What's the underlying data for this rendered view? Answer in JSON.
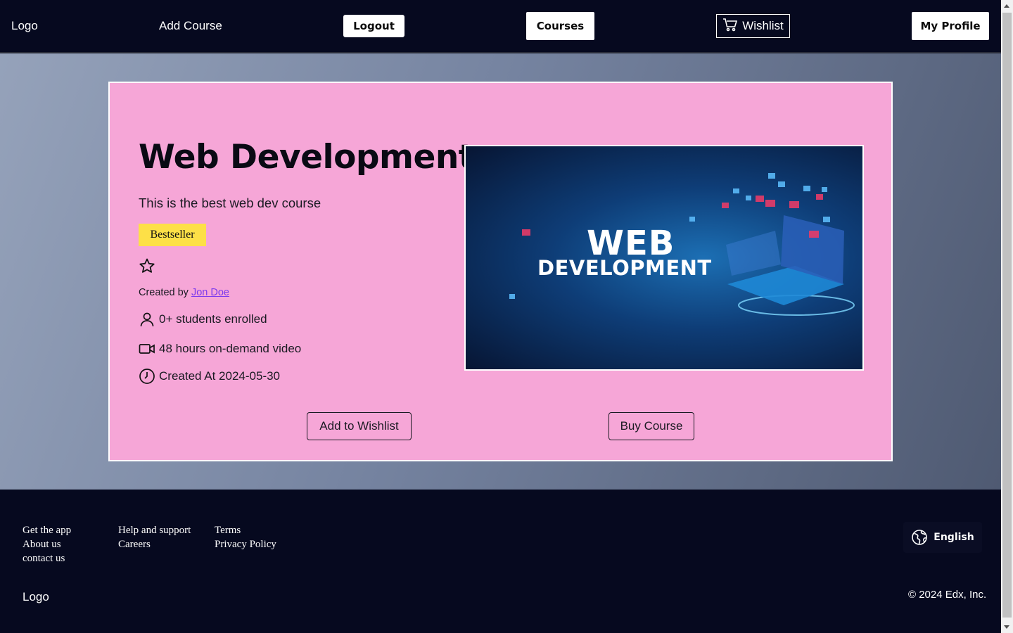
{
  "nav": {
    "logo": "Logo",
    "add_course": "Add Course",
    "logout": "Logout",
    "courses": "Courses",
    "wishlist": "Wishlist",
    "my_profile": "My Profile"
  },
  "course": {
    "title": "Web Development",
    "description": "This is the best web dev course",
    "badge": "Bestseller",
    "rating_stars": 0,
    "created_by_prefix": "Created by",
    "author": "Jon Doe",
    "students": "0+ students enrolled",
    "video": "48 hours on-demand video",
    "created_at": "Created At 2024-05-30",
    "image_text_line1": "WEB",
    "image_text_line2": "DEVELOPMENT",
    "add_to_wishlist": "Add to Wishlist",
    "buy_course": "Buy Course"
  },
  "footer": {
    "col1": [
      "Get the app",
      "About us",
      "contact us"
    ],
    "col2": [
      "Help and support",
      "Careers"
    ],
    "col3": [
      "Terms",
      "Privacy Policy"
    ],
    "language": "English",
    "logo": "Logo",
    "copyright": "© 2024 Edx, Inc."
  },
  "colors": {
    "nav_bg": "#06091f",
    "card_bg": "#f6a6d7",
    "badge_bg": "#fde047",
    "link": "#7c3aed"
  }
}
